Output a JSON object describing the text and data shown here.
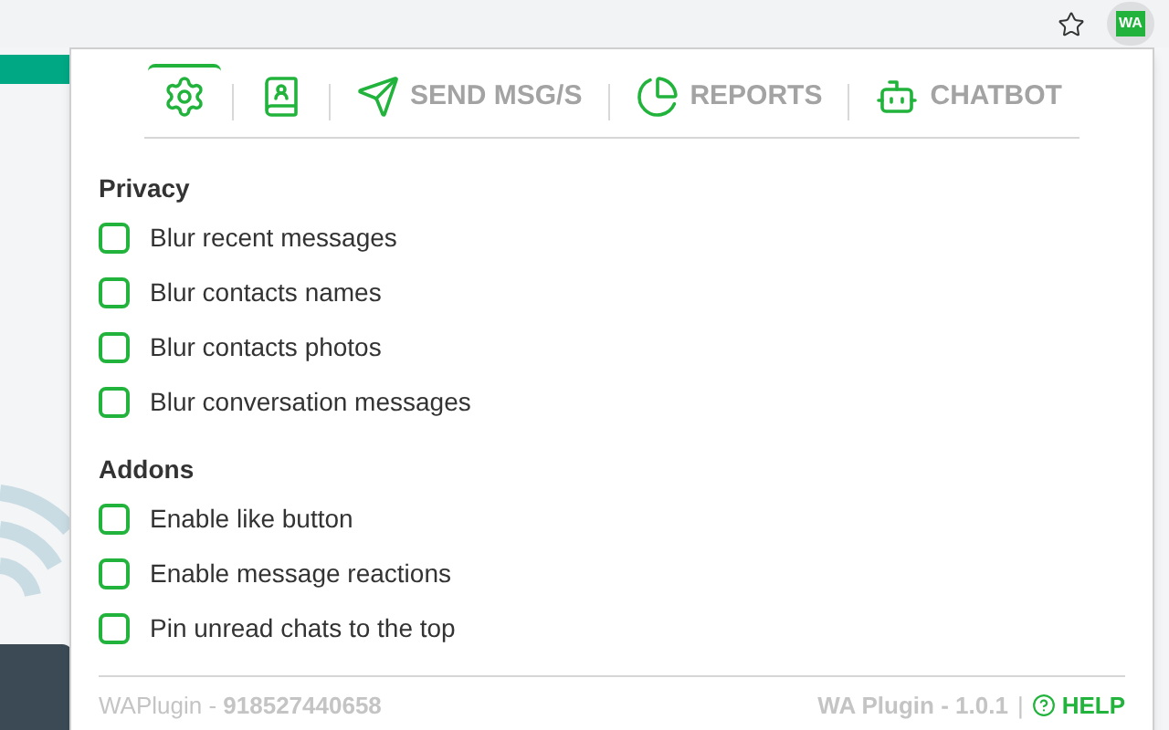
{
  "browser": {
    "extension_badge": "WA"
  },
  "tabs": [
    {
      "kind": "gear",
      "selected": true
    },
    {
      "kind": "contacts",
      "selected": false
    },
    {
      "kind": "send",
      "label": "SEND MSG/S",
      "selected": false
    },
    {
      "kind": "pie",
      "label": "REPORTS",
      "selected": false
    },
    {
      "kind": "robot",
      "label": "CHATBOT",
      "selected": false
    }
  ],
  "sections": [
    {
      "title": "Privacy",
      "options": [
        {
          "label": "Blur recent messages",
          "checked": false
        },
        {
          "label": "Blur contacts names",
          "checked": false
        },
        {
          "label": "Blur contacts photos",
          "checked": false
        },
        {
          "label": "Blur conversation messages",
          "checked": false
        }
      ]
    },
    {
      "title": "Addons",
      "options": [
        {
          "label": "Enable like button",
          "checked": false
        },
        {
          "label": "Enable message reactions",
          "checked": false
        },
        {
          "label": "Pin unread chats to the top",
          "checked": false
        }
      ]
    }
  ],
  "footer": {
    "account": "WAPlugin - **918527440658**",
    "version": "WA Plugin - 1.0.1",
    "separator": "|",
    "help": "HELP"
  }
}
